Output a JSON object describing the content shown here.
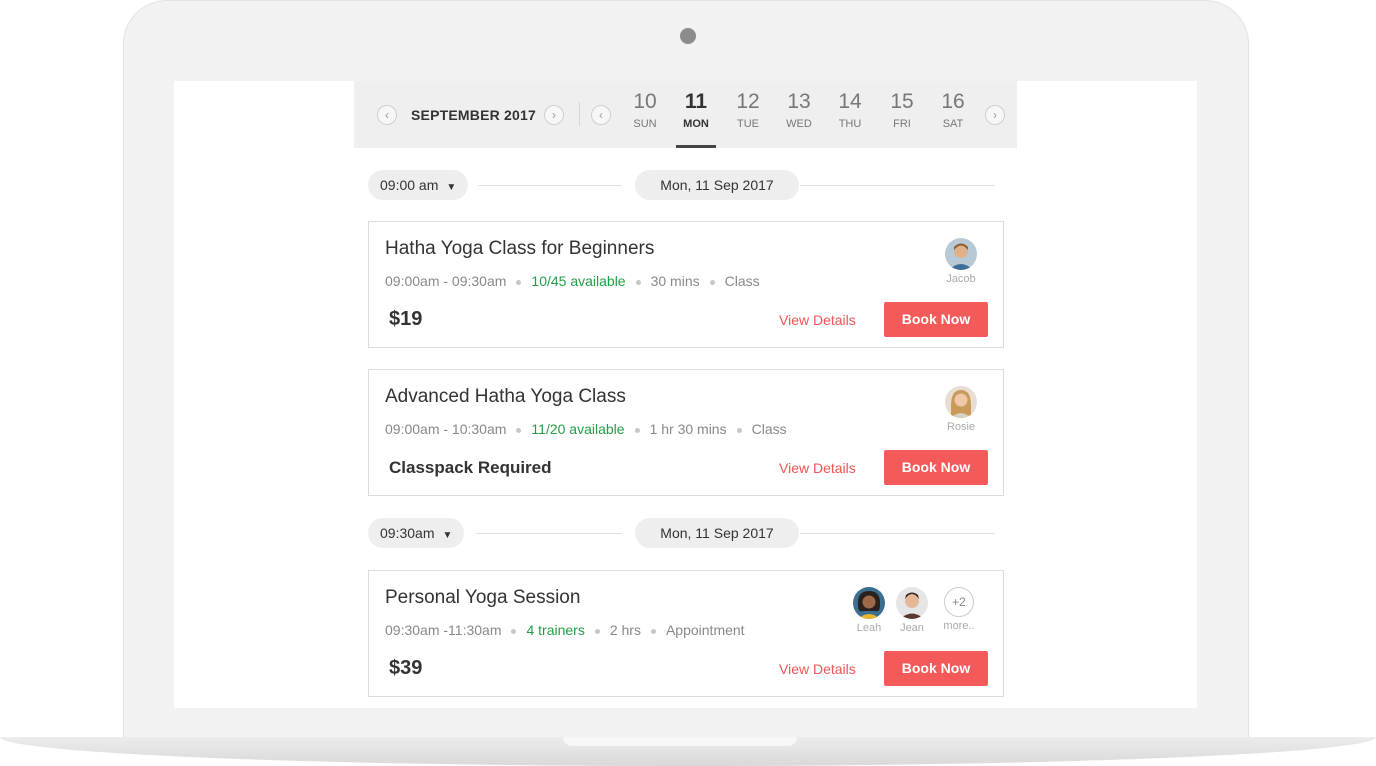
{
  "datebar": {
    "prev_month_icon": "chevron-left-icon",
    "month": "SEPTEMBER 2017",
    "next_month_icon": "chevron-right-icon",
    "prev_week_icon": "chevron-left-icon",
    "next_week_icon": "chevron-right-icon",
    "days": [
      {
        "num": "10",
        "name": "SUN",
        "active": false
      },
      {
        "num": "11",
        "name": "MON",
        "active": true
      },
      {
        "num": "12",
        "name": "TUE",
        "active": false
      },
      {
        "num": "13",
        "name": "WED",
        "active": false
      },
      {
        "num": "14",
        "name": "THU",
        "active": false
      },
      {
        "num": "15",
        "name": "FRI",
        "active": false
      },
      {
        "num": "16",
        "name": "SAT",
        "active": false
      }
    ]
  },
  "groups": [
    {
      "time": "09:00 am",
      "date": "Mon, 11 Sep 2017",
      "classes": [
        {
          "title": "Hatha Yoga Class for Beginners",
          "time_range": "09:00am - 09:30am",
          "availability": "10/45 available",
          "duration": "30 mins",
          "kind": "Class",
          "price": "$19",
          "view_details": "View Details",
          "book_now": "Book Now",
          "trainers": [
            "Jacob"
          ]
        },
        {
          "title": "Advanced Hatha Yoga Class",
          "time_range": "09:00am - 10:30am",
          "availability": "11/20 available",
          "duration": "1 hr 30 mins",
          "kind": "Class",
          "price": "Classpack Required",
          "view_details": "View Details",
          "book_now": "Book Now",
          "trainers": [
            "Rosie"
          ]
        }
      ]
    },
    {
      "time": "09:30am",
      "date": "Mon, 11 Sep 2017",
      "classes": [
        {
          "title": "Personal Yoga Session",
          "time_range": "09:30am -11:30am",
          "availability": "4 trainers",
          "duration": "2 hrs",
          "kind": "Appointment",
          "price": "$39",
          "view_details": "View Details",
          "book_now": "Book Now",
          "trainers": [
            "Leah",
            "Jean"
          ],
          "more_count": "+2",
          "more_label": "more.."
        }
      ]
    }
  ],
  "colors": {
    "accent": "#f55a5a",
    "available": "#20a045",
    "datebar_bg": "#efefef"
  }
}
